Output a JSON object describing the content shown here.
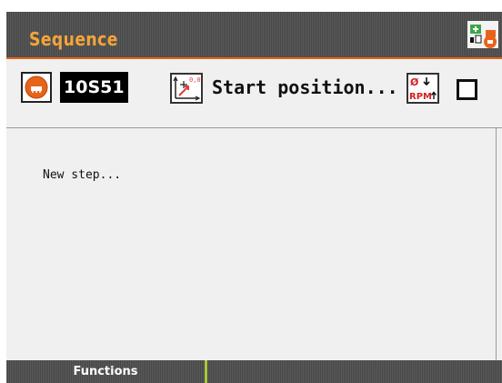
{
  "window": {
    "title": "Sequence",
    "app_icon": "sequence-app-icon"
  },
  "toolbar": {
    "tool_icon": "tool-disc-icon",
    "tool_value": "10S51",
    "position_icon": "coordinate-axes-icon",
    "position_label": "Start position...",
    "rpm_icon": "rpm-icon",
    "rpm_icon_text_top": "Ø",
    "rpm_icon_text_bottom": "RPM",
    "checkbox_checked": false
  },
  "content": {
    "steps": [
      "New step..."
    ]
  },
  "footer": {
    "functions_label": "Functions"
  },
  "colors": {
    "title_text": "#f4a43a",
    "accent": "#e8631a",
    "separator": "#a8c83a"
  }
}
